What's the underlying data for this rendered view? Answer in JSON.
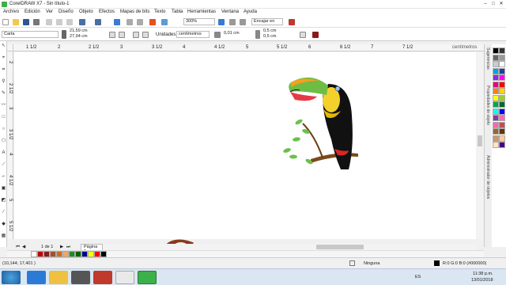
{
  "window": {
    "title": "CorelDRAW X7 - Sin título-1",
    "controls": [
      "–",
      "□",
      "✕"
    ]
  },
  "menu": [
    "Archivo",
    "Edición",
    "Ver",
    "Diseño",
    "Objeto",
    "Efectos",
    "Mapas de bits",
    "Texto",
    "Tabla",
    "Herramientas",
    "Ventana",
    "Ayuda"
  ],
  "toolbar": {
    "zoom": "300%",
    "snap": "Encajar en"
  },
  "properties": {
    "paper": "Carta",
    "width": "21,59 cm",
    "height": "27,94 cm",
    "units_label": "Unidades:",
    "units": "centímetros",
    "nudge": "0,01 cm",
    "dup_x": "0,5 cm",
    "dup_y": "0,5 cm"
  },
  "rulers": {
    "h_label": "centímetros",
    "h_ticks": [
      "1 1/2",
      "2",
      "2 1/2",
      "3",
      "3 1/2",
      "4",
      "4 1/2",
      "5",
      "5 1/2",
      "6",
      "6 1/2",
      "7",
      "7 1/2"
    ],
    "v_ticks": [
      "2",
      "2 1/2",
      "3",
      "3 1/2",
      "4",
      "4 1/2",
      "5",
      "5 1/2"
    ]
  },
  "canvas": {
    "text_first": "C",
    "text_rest": "rearte"
  },
  "dockers": [
    "Sugerencias",
    "Propiedades de objeto",
    "Administrador de objetos"
  ],
  "pages": {
    "counter": "1 de 1",
    "tab": "Página 1"
  },
  "status": {
    "coords": "(10,144; 17,401 )",
    "fill": "Ninguna",
    "color": "R:0 G:0 B:0 (#000000)"
  },
  "taskbar": {
    "time": "11:38 p.m.",
    "date": "13/01/2018",
    "lang": "ES"
  },
  "colors": {
    "palette": [
      "#000000",
      "#333333",
      "#666666",
      "#999999",
      "#cccccc",
      "#ffffff",
      "#00a2e8",
      "#1f3fa0",
      "#8a2be2",
      "#ff00ff",
      "#e4007c",
      "#ff0000",
      "#ff7f00",
      "#ffd400",
      "#ffff00",
      "#9acd32",
      "#00a651",
      "#006633",
      "#00ffff",
      "#0000ff",
      "#7f3f98",
      "#ff69b4",
      "#f6a",
      "#c0504d",
      "#996633",
      "#663300",
      "#cc9966",
      "#ffcc99",
      "#ffe4c4",
      "#4b0082"
    ],
    "bottom": [
      "#ffffff",
      "#c00000",
      "#8b1a1a",
      "#a0522d",
      "#d2691e",
      "#f4a460",
      "#228b22",
      "#006400",
      "#00008b",
      "#ffff00",
      "#ff0000",
      "#000000"
    ]
  }
}
